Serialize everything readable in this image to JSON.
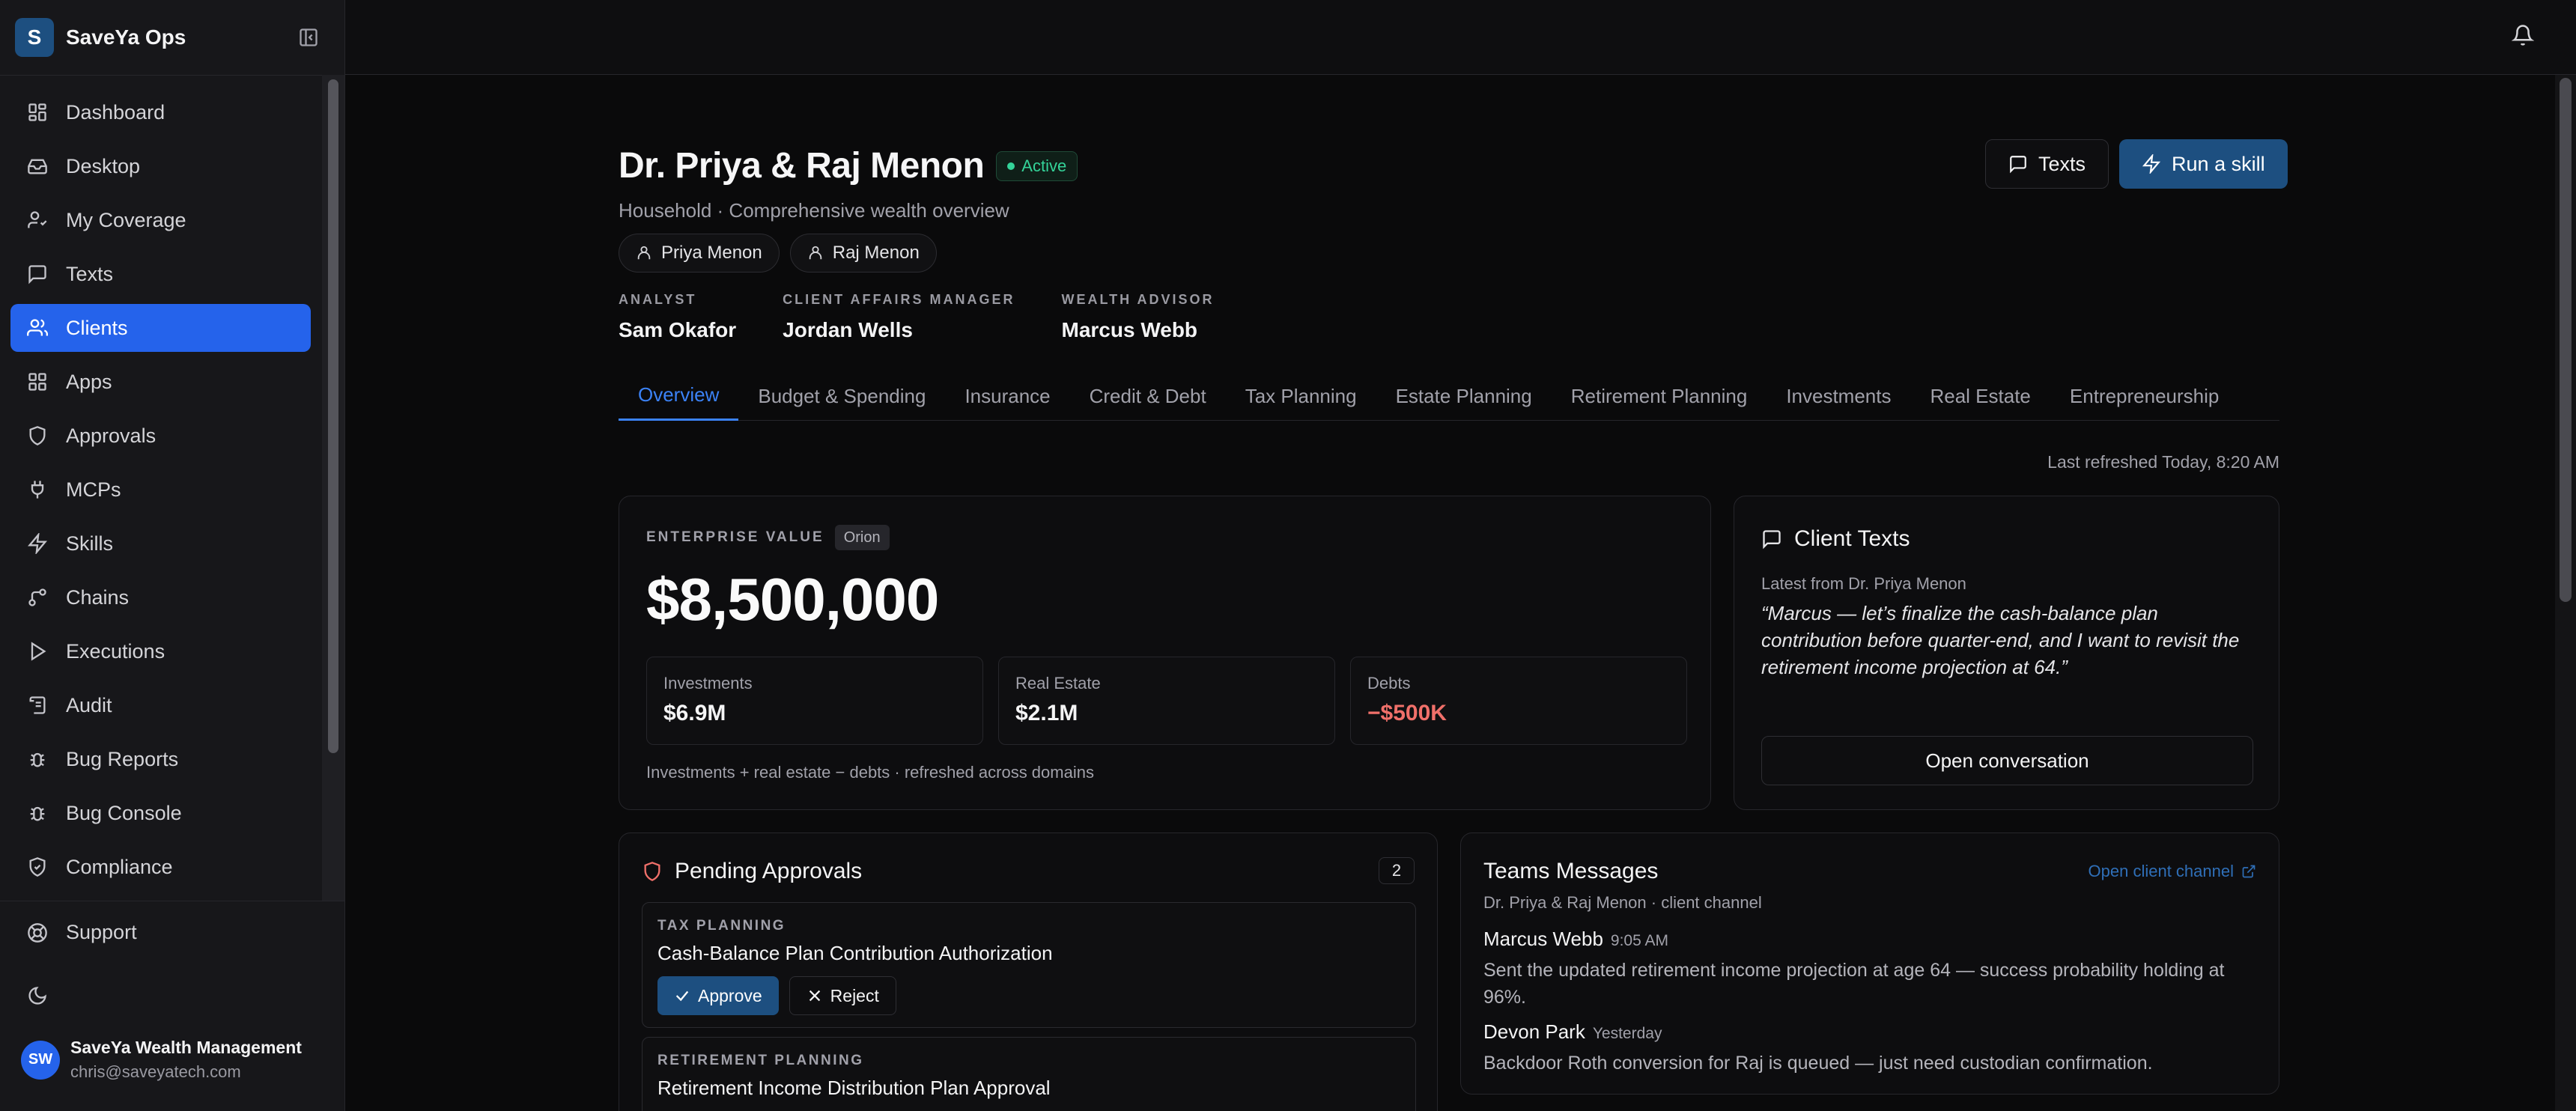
{
  "brand": {
    "logo_letter": "S",
    "name": "SaveYa Ops"
  },
  "nav": [
    {
      "label": "Dashboard",
      "icon": "dashboard-icon"
    },
    {
      "label": "Desktop",
      "icon": "inbox-icon"
    },
    {
      "label": "My Coverage",
      "icon": "user-check-icon"
    },
    {
      "label": "Texts",
      "icon": "message-icon"
    },
    {
      "label": "Clients",
      "icon": "users-icon",
      "active": true
    },
    {
      "label": "Apps",
      "icon": "apps-grid-icon"
    },
    {
      "label": "Approvals",
      "icon": "shield-icon"
    },
    {
      "label": "MCPs",
      "icon": "plug-icon"
    },
    {
      "label": "Skills",
      "icon": "lightning-icon"
    },
    {
      "label": "Chains",
      "icon": "chain-icon"
    },
    {
      "label": "Executions",
      "icon": "play-icon"
    },
    {
      "label": "Audit",
      "icon": "scroll-icon"
    },
    {
      "label": "Bug Reports",
      "icon": "bug-icon"
    },
    {
      "label": "Bug Console",
      "icon": "bug-icon"
    },
    {
      "label": "Compliance",
      "icon": "shield-check-icon"
    }
  ],
  "support": {
    "label": "Support"
  },
  "user": {
    "initials": "SW",
    "org": "SaveYa Wealth Management",
    "email": "chris@saveyatech.com"
  },
  "header": {
    "title": "Dr. Priya & Raj Menon",
    "status": "Active",
    "subtitle": "Household · Comprehensive wealth overview",
    "members": [
      "Priya Menon",
      "Raj Menon"
    ],
    "team": [
      {
        "role": "ANALYST",
        "name": "Sam Okafor"
      },
      {
        "role": "CLIENT AFFAIRS MANAGER",
        "name": "Jordan Wells"
      },
      {
        "role": "WEALTH ADVISOR",
        "name": "Marcus Webb"
      }
    ],
    "texts_button": "Texts",
    "run_button": "Run a skill"
  },
  "tabs": [
    "Overview",
    "Budget & Spending",
    "Insurance",
    "Credit & Debt",
    "Tax Planning",
    "Estate Planning",
    "Retirement Planning",
    "Investments",
    "Real Estate",
    "Entrepreneurship"
  ],
  "refreshed": "Last refreshed Today, 8:20 AM",
  "enterprise": {
    "label": "ENTERPRISE VALUE",
    "badge": "Orion",
    "value": "$8,500,000",
    "stats": [
      {
        "label": "Investments",
        "value": "$6.9M"
      },
      {
        "label": "Real Estate",
        "value": "$2.1M"
      },
      {
        "label": "Debts",
        "value": "−$500K"
      }
    ],
    "footnote": "Investments + real estate − debts · refreshed across domains"
  },
  "client_texts": {
    "title": "Client Texts",
    "sub": "Latest from Dr. Priya Menon",
    "quote": "“Marcus — let’s finalize the cash-balance plan contribution before quarter-end, and I want to revisit the retirement income projection at 64.”",
    "button": "Open conversation"
  },
  "approvals": {
    "title": "Pending Approvals",
    "count": "2",
    "items": [
      {
        "category": "TAX PLANNING",
        "name": "Cash-Balance Plan Contribution Authorization"
      },
      {
        "category": "RETIREMENT PLANNING",
        "name": "Retirement Income Distribution Plan Approval"
      }
    ],
    "approve_label": "Approve",
    "reject_label": "Reject"
  },
  "teams": {
    "title": "Teams Messages",
    "link": "Open client channel",
    "sub": "Dr. Priya & Raj Menon · client channel",
    "messages": [
      {
        "author": "Marcus Webb",
        "time": "9:05 AM",
        "body": "Sent the updated retirement income projection at age 64 — success probability holding at 96%."
      },
      {
        "author": "Devon Park",
        "time": "Yesterday",
        "body": "Backdoor Roth conversion for Raj is queued — just need custodian confirmation."
      }
    ]
  },
  "colors": {
    "accent": "#2563eb",
    "primary_button": "#1d4f80",
    "success": "#34d399",
    "negative": "#f0706a",
    "link": "#2f6fb8"
  }
}
